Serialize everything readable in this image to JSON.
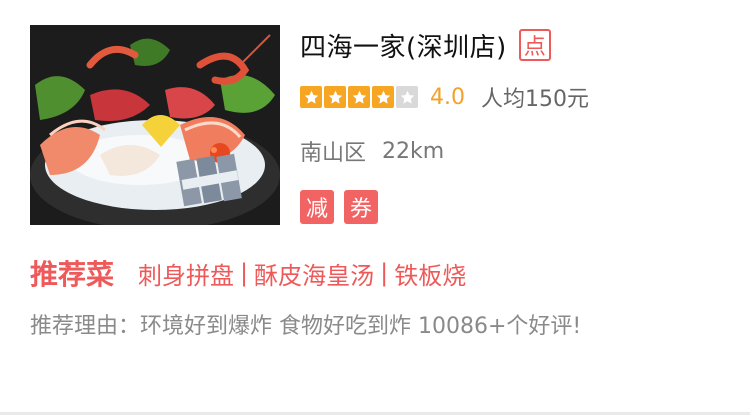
{
  "shop": {
    "name": "四海一家(深圳店)",
    "dian_badge": "点",
    "rating_value": 4.0,
    "rating_max": 5,
    "score": "4.0",
    "avg_price": "人均150元",
    "district": "南山区",
    "distance": "22km",
    "tags": [
      "减",
      "券"
    ]
  },
  "recommend": {
    "title": "推荐菜",
    "dishes": [
      "刺身拼盘",
      "酥皮海皇汤",
      "铁板烧"
    ],
    "separator": "|",
    "reason": "推荐理由：环境好到爆炸 食物好吃到炸 10086+个好评!"
  },
  "icons": {
    "star_filled": "star-filled-icon",
    "star_empty": "star-empty-icon"
  },
  "colors": {
    "accent_red": "#ee5a5a",
    "star_orange": "#f6a623",
    "star_empty": "#d9d9d9"
  }
}
